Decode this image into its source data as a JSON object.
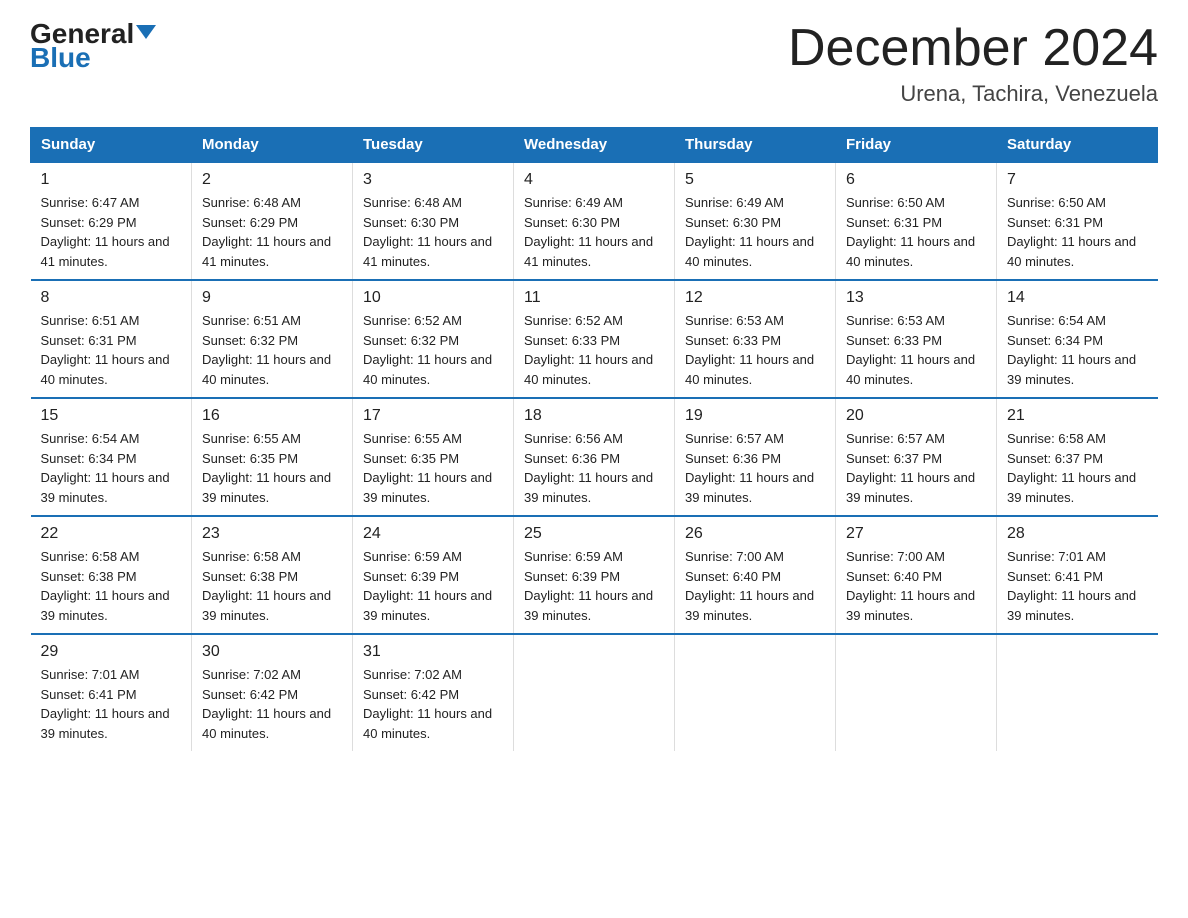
{
  "logo": {
    "general": "General",
    "arrow": "▼",
    "blue": "Blue"
  },
  "header": {
    "title": "December 2024",
    "subtitle": "Urena, Tachira, Venezuela"
  },
  "days_of_week": [
    "Sunday",
    "Monday",
    "Tuesday",
    "Wednesday",
    "Thursday",
    "Friday",
    "Saturday"
  ],
  "weeks": [
    [
      {
        "day": "1",
        "sunrise": "6:47 AM",
        "sunset": "6:29 PM",
        "daylight": "11 hours and 41 minutes."
      },
      {
        "day": "2",
        "sunrise": "6:48 AM",
        "sunset": "6:29 PM",
        "daylight": "11 hours and 41 minutes."
      },
      {
        "day": "3",
        "sunrise": "6:48 AM",
        "sunset": "6:30 PM",
        "daylight": "11 hours and 41 minutes."
      },
      {
        "day": "4",
        "sunrise": "6:49 AM",
        "sunset": "6:30 PM",
        "daylight": "11 hours and 41 minutes."
      },
      {
        "day": "5",
        "sunrise": "6:49 AM",
        "sunset": "6:30 PM",
        "daylight": "11 hours and 40 minutes."
      },
      {
        "day": "6",
        "sunrise": "6:50 AM",
        "sunset": "6:31 PM",
        "daylight": "11 hours and 40 minutes."
      },
      {
        "day": "7",
        "sunrise": "6:50 AM",
        "sunset": "6:31 PM",
        "daylight": "11 hours and 40 minutes."
      }
    ],
    [
      {
        "day": "8",
        "sunrise": "6:51 AM",
        "sunset": "6:31 PM",
        "daylight": "11 hours and 40 minutes."
      },
      {
        "day": "9",
        "sunrise": "6:51 AM",
        "sunset": "6:32 PM",
        "daylight": "11 hours and 40 minutes."
      },
      {
        "day": "10",
        "sunrise": "6:52 AM",
        "sunset": "6:32 PM",
        "daylight": "11 hours and 40 minutes."
      },
      {
        "day": "11",
        "sunrise": "6:52 AM",
        "sunset": "6:33 PM",
        "daylight": "11 hours and 40 minutes."
      },
      {
        "day": "12",
        "sunrise": "6:53 AM",
        "sunset": "6:33 PM",
        "daylight": "11 hours and 40 minutes."
      },
      {
        "day": "13",
        "sunrise": "6:53 AM",
        "sunset": "6:33 PM",
        "daylight": "11 hours and 40 minutes."
      },
      {
        "day": "14",
        "sunrise": "6:54 AM",
        "sunset": "6:34 PM",
        "daylight": "11 hours and 39 minutes."
      }
    ],
    [
      {
        "day": "15",
        "sunrise": "6:54 AM",
        "sunset": "6:34 PM",
        "daylight": "11 hours and 39 minutes."
      },
      {
        "day": "16",
        "sunrise": "6:55 AM",
        "sunset": "6:35 PM",
        "daylight": "11 hours and 39 minutes."
      },
      {
        "day": "17",
        "sunrise": "6:55 AM",
        "sunset": "6:35 PM",
        "daylight": "11 hours and 39 minutes."
      },
      {
        "day": "18",
        "sunrise": "6:56 AM",
        "sunset": "6:36 PM",
        "daylight": "11 hours and 39 minutes."
      },
      {
        "day": "19",
        "sunrise": "6:57 AM",
        "sunset": "6:36 PM",
        "daylight": "11 hours and 39 minutes."
      },
      {
        "day": "20",
        "sunrise": "6:57 AM",
        "sunset": "6:37 PM",
        "daylight": "11 hours and 39 minutes."
      },
      {
        "day": "21",
        "sunrise": "6:58 AM",
        "sunset": "6:37 PM",
        "daylight": "11 hours and 39 minutes."
      }
    ],
    [
      {
        "day": "22",
        "sunrise": "6:58 AM",
        "sunset": "6:38 PM",
        "daylight": "11 hours and 39 minutes."
      },
      {
        "day": "23",
        "sunrise": "6:58 AM",
        "sunset": "6:38 PM",
        "daylight": "11 hours and 39 minutes."
      },
      {
        "day": "24",
        "sunrise": "6:59 AM",
        "sunset": "6:39 PM",
        "daylight": "11 hours and 39 minutes."
      },
      {
        "day": "25",
        "sunrise": "6:59 AM",
        "sunset": "6:39 PM",
        "daylight": "11 hours and 39 minutes."
      },
      {
        "day": "26",
        "sunrise": "7:00 AM",
        "sunset": "6:40 PM",
        "daylight": "11 hours and 39 minutes."
      },
      {
        "day": "27",
        "sunrise": "7:00 AM",
        "sunset": "6:40 PM",
        "daylight": "11 hours and 39 minutes."
      },
      {
        "day": "28",
        "sunrise": "7:01 AM",
        "sunset": "6:41 PM",
        "daylight": "11 hours and 39 minutes."
      }
    ],
    [
      {
        "day": "29",
        "sunrise": "7:01 AM",
        "sunset": "6:41 PM",
        "daylight": "11 hours and 39 minutes."
      },
      {
        "day": "30",
        "sunrise": "7:02 AM",
        "sunset": "6:42 PM",
        "daylight": "11 hours and 40 minutes."
      },
      {
        "day": "31",
        "sunrise": "7:02 AM",
        "sunset": "6:42 PM",
        "daylight": "11 hours and 40 minutes."
      },
      null,
      null,
      null,
      null
    ]
  ],
  "labels": {
    "sunrise_prefix": "Sunrise: ",
    "sunset_prefix": "Sunset: ",
    "daylight_prefix": "Daylight: "
  }
}
